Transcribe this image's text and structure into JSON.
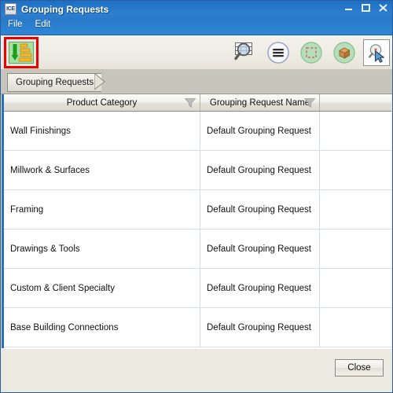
{
  "window": {
    "app_icon_label": "ICE",
    "title": "Grouping Requests",
    "buttons": {
      "minimize": "minimize-button",
      "maximize": "maximize-button",
      "close": "close-button"
    }
  },
  "menubar": {
    "items": [
      {
        "label": "File"
      },
      {
        "label": "Edit"
      }
    ]
  },
  "toolbar": {
    "highlighted_button": {
      "name": "sort-descending-button",
      "icon": "sort-descending-icon",
      "highlight_color": "#ee0000",
      "icon_bg": "#a9e0a2",
      "arrow_color": "#2aa02a",
      "bar_color": "#f5a623"
    },
    "right_buttons": [
      {
        "name": "find-in-table-button",
        "icon": "magnifier-grid-icon"
      },
      {
        "name": "list-menu-button",
        "icon": "hamburger-circle-icon"
      },
      {
        "name": "select-region-button",
        "icon": "dashed-square-circle-icon"
      },
      {
        "name": "model-object-button",
        "icon": "box-3d-circle-icon"
      },
      {
        "name": "pick-zoom-button",
        "icon": "magnifier-cursor-icon"
      }
    ]
  },
  "breadcrumb": {
    "items": [
      {
        "label": "Grouping Requests"
      }
    ]
  },
  "table": {
    "columns": [
      {
        "key": "product_category",
        "label": "Product Category",
        "filter_icon": "filter-funnel-icon"
      },
      {
        "key": "grouping_request_name",
        "label": "Grouping Request Name",
        "filter_icon": "filter-funnel-icon"
      },
      {
        "key": "spare",
        "label": "",
        "filter_icon": ""
      }
    ],
    "rows": [
      {
        "product_category": "Wall Finishings",
        "grouping_request_name": "Default Grouping Request",
        "spare": ""
      },
      {
        "product_category": "Millwork & Surfaces",
        "grouping_request_name": "Default Grouping Request",
        "spare": ""
      },
      {
        "product_category": "Framing",
        "grouping_request_name": "Default Grouping Request",
        "spare": ""
      },
      {
        "product_category": "Drawings & Tools",
        "grouping_request_name": "Default Grouping Request",
        "spare": ""
      },
      {
        "product_category": "Custom & Client Specialty",
        "grouping_request_name": "Default Grouping Request",
        "spare": ""
      },
      {
        "product_category": "Base Building Connections",
        "grouping_request_name": "Default Grouping Request",
        "spare": ""
      }
    ]
  },
  "footer": {
    "close_label": "Close"
  },
  "colors": {
    "titlebar_blue": "#2d7fd0",
    "window_border": "#2c5d9b",
    "panel_bg": "#ece9e1",
    "breadcrumb_strip": "#c8c5bd",
    "grid_line": "#d6dce4",
    "table_left_accent": "#2c6fbd"
  }
}
